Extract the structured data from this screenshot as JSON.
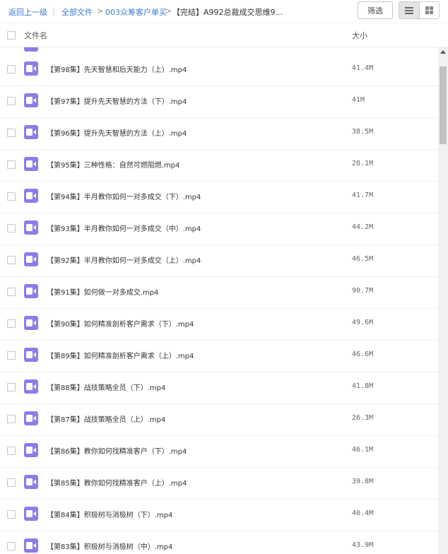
{
  "breadcrumb": {
    "back": "返回上一级",
    "separator": "|",
    "all_files": "全部文件",
    "arrow": ">",
    "folder": "003众筹客户单买",
    "current": "【完结】A992总裁成交思维9..."
  },
  "toolbar": {
    "filter_label": "筛选",
    "view_mode": "list"
  },
  "table": {
    "col_name": "文件名",
    "col_size": "大小"
  },
  "files": [
    {
      "name": "【第98集】先天智慧和后天能力（上）.mp4",
      "size": "41.4M"
    },
    {
      "name": "【第97集】提升先天智慧的方法（下）.mp4",
      "size": "41M"
    },
    {
      "name": "【第96集】提升先天智慧的方法（上）.mp4",
      "size": "38.5M"
    },
    {
      "name": "【第95集】三种性格：自然可燃阻燃.mp4",
      "size": "28.1M"
    },
    {
      "name": "【第94集】半月教你如何一对多成交（下）.mp4",
      "size": "41.7M"
    },
    {
      "name": "【第93集】半月教你如何一对多成交（中）.mp4",
      "size": "44.2M"
    },
    {
      "name": "【第92集】半月教你如何一对多成交（上）.mp4",
      "size": "46.5M"
    },
    {
      "name": "【第91集】如何做一对多成交.mp4",
      "size": "90.7M"
    },
    {
      "name": "【第90集】如何精准剖析客户需求（下）.mp4",
      "size": "49.6M"
    },
    {
      "name": "【第89集】如何精准剖析客户需求（上）.mp4",
      "size": "46.6M"
    },
    {
      "name": "【第88集】战技策略全员（下）.mp4",
      "size": "41.8M"
    },
    {
      "name": "【第87集】战技策略全员（上）.mp4",
      "size": "26.3M"
    },
    {
      "name": "【第86集】教你如何找精准客户（下）.mp4",
      "size": "46.1M"
    },
    {
      "name": "【第85集】教你如何找精准客户（上）.mp4",
      "size": "39.8M"
    },
    {
      "name": "【第84集】积极树与消极树（下）.mp4",
      "size": "40.4M"
    },
    {
      "name": "【第83集】积极树与消极树（中）.mp4",
      "size": "43.9M"
    }
  ],
  "colors": {
    "link": "#3a7ad0",
    "video_icon": "#8c7de8"
  },
  "icons": {
    "file_type": "video-file-icon",
    "list_view": "list-view-icon",
    "grid_view": "grid-view-icon",
    "scroll_up": "scroll-up-arrow-icon"
  }
}
